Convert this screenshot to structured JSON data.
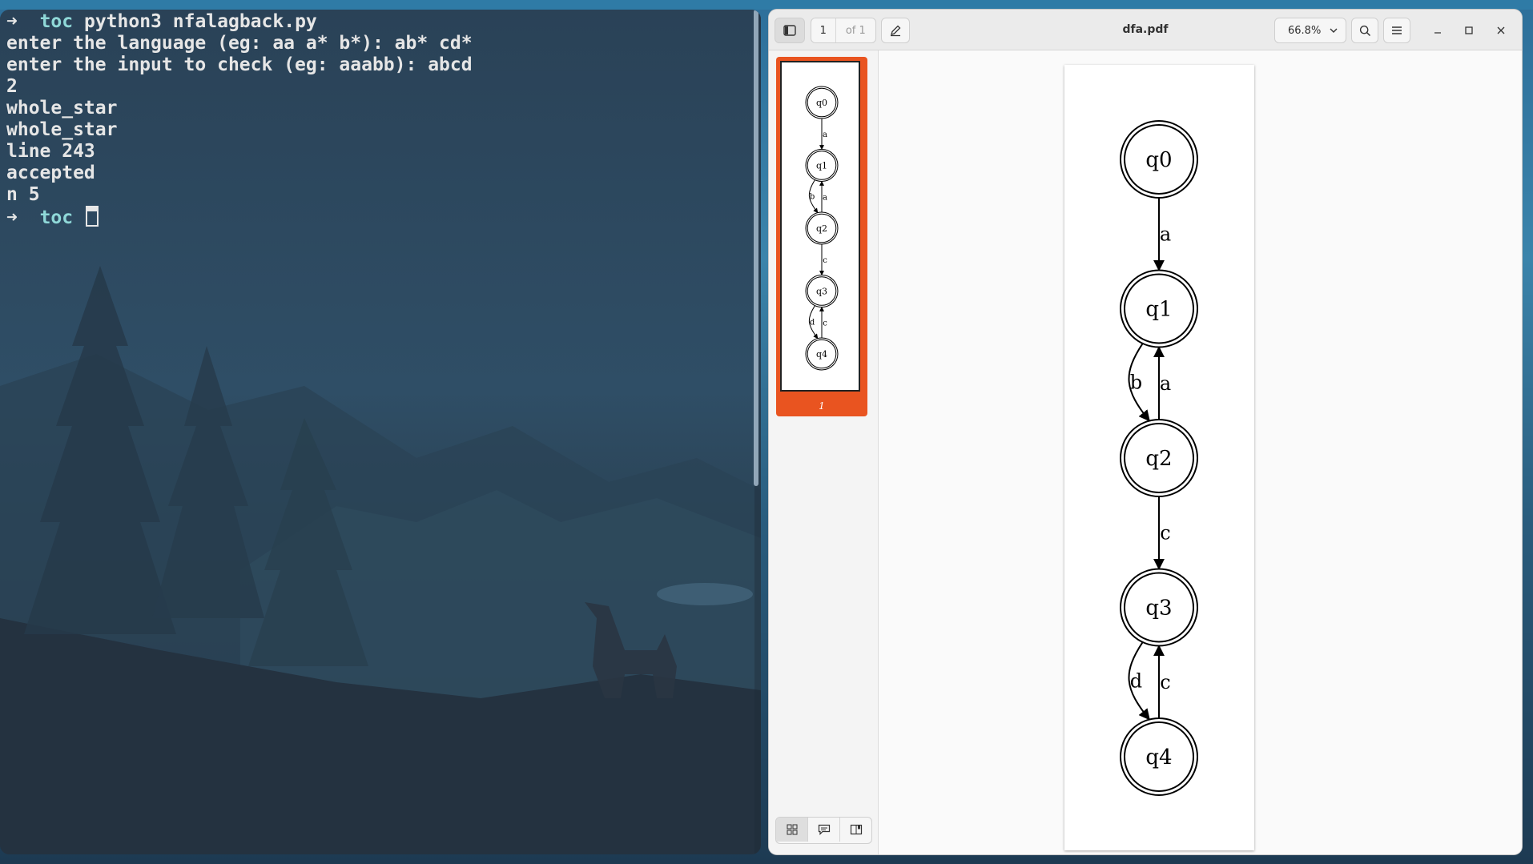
{
  "terminal": {
    "lines": [
      {
        "arrow": "➜",
        "dir": "toc",
        "text": "python3 nfalagback.py"
      },
      {
        "text": "enter the language (eg: aa a* b*): ab* cd*"
      },
      {
        "text": "enter the input to check (eg: aaabb): abcd"
      },
      {
        "text": "2"
      },
      {
        "text": "whole_star"
      },
      {
        "text": "whole_star"
      },
      {
        "text": "line 243"
      },
      {
        "text": "accepted"
      },
      {
        "text": "n 5"
      },
      {
        "arrow": "➜",
        "dir": "toc",
        "text": ""
      }
    ]
  },
  "viewer": {
    "title": "dfa.pdf",
    "page_number": "1",
    "page_of": "of 1",
    "zoom": "66.8%",
    "thumbnail_label": "1",
    "accent_color": "#e95420",
    "icons": {
      "sidebar_toggle": "sidebar-toggle-icon",
      "annotate": "pencil-icon",
      "zoom_dropdown": "chevron-down-icon",
      "search": "search-icon",
      "menu": "hamburger-menu-icon",
      "minimize": "minimize-icon",
      "maximize": "maximize-icon",
      "close": "close-icon",
      "thumbnails": "grid-icon",
      "annotations": "comment-icon",
      "bookmarks": "bookmark-icon"
    }
  },
  "diagram": {
    "states": [
      "q0",
      "q1",
      "q2",
      "q3",
      "q4"
    ],
    "accepting": [
      "q0",
      "q1",
      "q2",
      "q3",
      "q4"
    ],
    "transitions": [
      {
        "from": "q0",
        "to": "q1",
        "label": "a"
      },
      {
        "from": "q1",
        "to": "q2",
        "label": "b"
      },
      {
        "from": "q2",
        "to": "q1",
        "label": "a"
      },
      {
        "from": "q2",
        "to": "q3",
        "label": "c"
      },
      {
        "from": "q3",
        "to": "q4",
        "label": "d"
      },
      {
        "from": "q4",
        "to": "q3",
        "label": "c"
      }
    ]
  }
}
